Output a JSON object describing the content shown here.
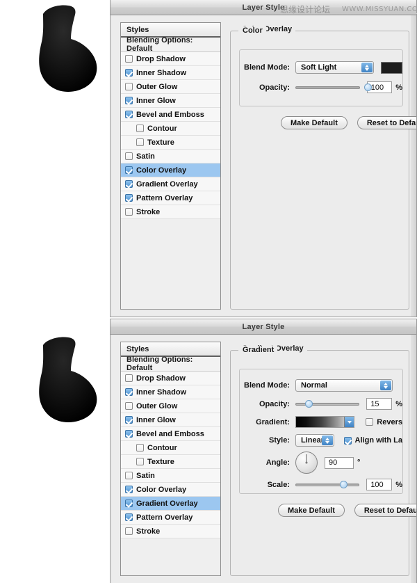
{
  "watermark": {
    "chinese": "思缘设计论坛",
    "english": "WWW.MISSYUAN.COM"
  },
  "dialogs": [
    {
      "title": "Layer Style",
      "styles_panel": {
        "header": "Styles",
        "blending_options": "Blending Options: Default",
        "effects": [
          {
            "label": "Drop Shadow",
            "checked": false,
            "indent": false,
            "selected": false
          },
          {
            "label": "Inner Shadow",
            "checked": true,
            "indent": false,
            "selected": false
          },
          {
            "label": "Outer Glow",
            "checked": false,
            "indent": false,
            "selected": false
          },
          {
            "label": "Inner Glow",
            "checked": true,
            "indent": false,
            "selected": false
          },
          {
            "label": "Bevel and Emboss",
            "checked": true,
            "indent": false,
            "selected": false
          },
          {
            "label": "Contour",
            "checked": false,
            "indent": true,
            "selected": false
          },
          {
            "label": "Texture",
            "checked": false,
            "indent": true,
            "selected": false
          },
          {
            "label": "Satin",
            "checked": false,
            "indent": false,
            "selected": false
          },
          {
            "label": "Color Overlay",
            "checked": true,
            "indent": false,
            "selected": true
          },
          {
            "label": "Gradient Overlay",
            "checked": true,
            "indent": false,
            "selected": false
          },
          {
            "label": "Pattern Overlay",
            "checked": true,
            "indent": false,
            "selected": false
          },
          {
            "label": "Stroke",
            "checked": false,
            "indent": false,
            "selected": false
          }
        ]
      },
      "panel": {
        "group_title": "Color Overlay",
        "subgroup_title": "Color",
        "blend_mode_label": "Blend Mode:",
        "blend_mode_value": "Soft Light",
        "color_swatch": "#1d1d1d",
        "opacity_label": "Opacity:",
        "opacity_value": "100",
        "opacity_unit": "%",
        "opacity_percent": 100,
        "make_default": "Make Default",
        "reset_to_default": "Reset to Default"
      }
    },
    {
      "title": "Layer Style",
      "styles_panel": {
        "header": "Styles",
        "blending_options": "Blending Options: Default",
        "effects": [
          {
            "label": "Drop Shadow",
            "checked": false,
            "indent": false,
            "selected": false
          },
          {
            "label": "Inner Shadow",
            "checked": true,
            "indent": false,
            "selected": false
          },
          {
            "label": "Outer Glow",
            "checked": false,
            "indent": false,
            "selected": false
          },
          {
            "label": "Inner Glow",
            "checked": true,
            "indent": false,
            "selected": false
          },
          {
            "label": "Bevel and Emboss",
            "checked": true,
            "indent": false,
            "selected": false
          },
          {
            "label": "Contour",
            "checked": false,
            "indent": true,
            "selected": false
          },
          {
            "label": "Texture",
            "checked": false,
            "indent": true,
            "selected": false
          },
          {
            "label": "Satin",
            "checked": false,
            "indent": false,
            "selected": false
          },
          {
            "label": "Color Overlay",
            "checked": true,
            "indent": false,
            "selected": false
          },
          {
            "label": "Gradient Overlay",
            "checked": true,
            "indent": false,
            "selected": true
          },
          {
            "label": "Pattern Overlay",
            "checked": true,
            "indent": false,
            "selected": false
          },
          {
            "label": "Stroke",
            "checked": false,
            "indent": false,
            "selected": false
          }
        ]
      },
      "panel": {
        "group_title": "Gradient Overlay",
        "subgroup_title": "Gradient",
        "blend_mode_label": "Blend Mode:",
        "blend_mode_value": "Normal",
        "opacity_label": "Opacity:",
        "opacity_value": "15",
        "opacity_unit": "%",
        "opacity_percent": 15,
        "gradient_label": "Gradient:",
        "gradient_from": "#000000",
        "gradient_to": "#ffffff",
        "reverse_label": "Revers",
        "reverse_checked": false,
        "style_label": "Style:",
        "style_value": "Linear",
        "align_label": "Align with La",
        "align_checked": true,
        "angle_label": "Angle:",
        "angle_value": "90",
        "angle_unit": "°",
        "scale_label": "Scale:",
        "scale_value": "100",
        "scale_unit": "%",
        "scale_percent": 100,
        "make_default": "Make Default",
        "reset_to_default": "Reset to Default"
      }
    }
  ]
}
